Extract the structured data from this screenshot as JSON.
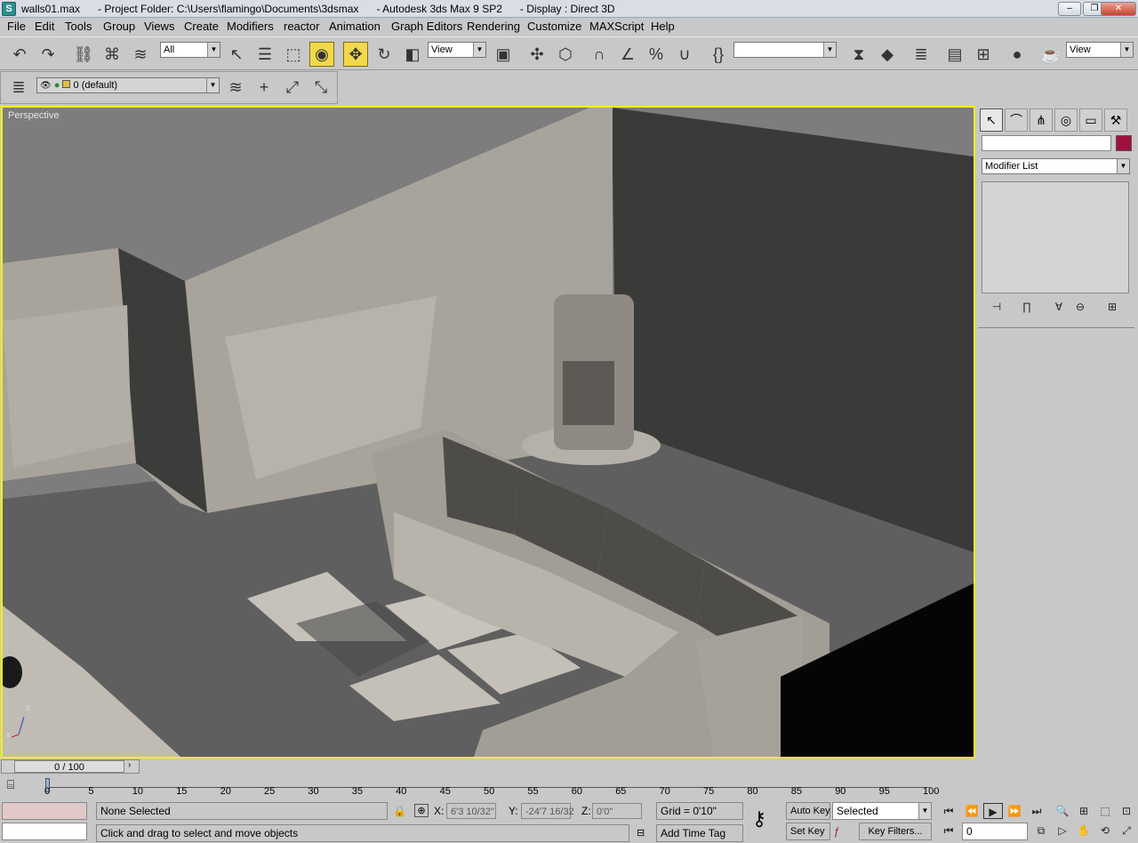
{
  "window": {
    "title": "walls01.max      - Project Folder: C:\\Users\\flamingo\\Documents\\3dsmax      - Autodesk 3ds Max 9 SP2      - Display : Direct 3D",
    "minimize": "‒",
    "maximize": "❐",
    "close": "✕"
  },
  "menu": [
    "File",
    "Edit",
    "Tools",
    "Group",
    "Views",
    "Create",
    "Modifiers",
    "reactor",
    "Animation",
    "Graph Editors",
    "Rendering",
    "Customize",
    "MAXScript",
    "Help"
  ],
  "toolbar": {
    "selection_filter": "All",
    "ref_coord": "View",
    "named_selection": "",
    "view_dropdown": "View"
  },
  "layer": {
    "current": "0 (default)"
  },
  "viewport": {
    "label": "Perspective",
    "axis_x": "x",
    "axis_z": "z"
  },
  "command_panel": {
    "modifier_list": "Modifier List",
    "name_field": "",
    "color_swatch": "#a0103c"
  },
  "time": {
    "slider_label": "0 / 100",
    "ticks": [
      "0",
      "5",
      "10",
      "15",
      "20",
      "25",
      "30",
      "35",
      "40",
      "45",
      "50",
      "55",
      "60",
      "65",
      "70",
      "75",
      "80",
      "85",
      "90",
      "95",
      "100"
    ]
  },
  "status": {
    "selection": "None Selected",
    "prompt": "Click and drag to select and move objects",
    "x_label": "X:",
    "x_value": "6'3 10/32\"",
    "y_label": "Y:",
    "y_value": "-24'7 16/32",
    "z_label": "Z:",
    "z_value": "0'0\"",
    "grid": "Grid = 0'10\"",
    "add_time_tag": "Add Time Tag",
    "auto_key": "Auto Key",
    "set_key": "Set Key",
    "key_mode": "Selected",
    "key_filters": "Key Filters...",
    "frame": "0"
  }
}
